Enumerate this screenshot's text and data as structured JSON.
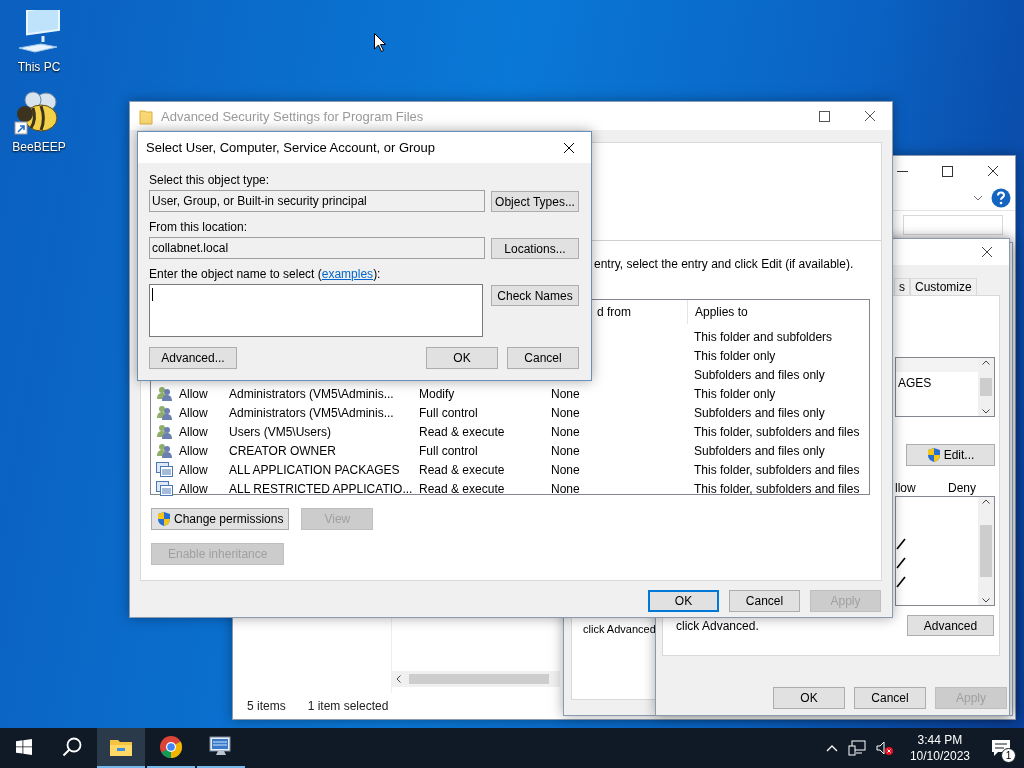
{
  "desktop_icons": [
    {
      "kind": "pc",
      "label": "This PC"
    },
    {
      "kind": "bee",
      "label": "BeeBEEP"
    }
  ],
  "explorer_window": {
    "status": [
      "5 items",
      "1 item selected"
    ]
  },
  "properties_back": {
    "note": "click Advanced"
  },
  "properties_front": {
    "tabs": [
      {
        "label": "s",
        "selected": false
      },
      {
        "label": "Customize",
        "selected": false
      }
    ],
    "group_items": [
      "AGES"
    ],
    "edit_button": "Edit...",
    "permission_columns": [
      "llow",
      "Deny"
    ],
    "permissions": [
      {
        "allowed": true
      },
      {
        "allowed": true
      },
      {
        "allowed": true
      }
    ],
    "note": "click Advanced.",
    "advanced_button": "Advanced",
    "buttons": [
      {
        "label": "OK",
        "disabled": false
      },
      {
        "label": "Cancel",
        "disabled": false
      },
      {
        "label": "Apply",
        "disabled": true
      }
    ]
  },
  "advanced_security": {
    "title": "Advanced Security Settings for Program Files",
    "instruction": "entry, select the entry and click Edit (if available).",
    "columns": [
      "d from",
      "Applies to"
    ],
    "entries": [
      {
        "applies_to": "This folder and subfolders"
      },
      {
        "applies_to": "This folder only"
      },
      {
        "applies_to": "Subfolders and files only"
      },
      {
        "kind": "users",
        "type": "Allow",
        "principal": "Administrators (VM5\\Adminis...",
        "access": "Modify",
        "inherited_from": "None",
        "applies_to": "This folder only"
      },
      {
        "kind": "users",
        "type": "Allow",
        "principal": "Administrators (VM5\\Adminis...",
        "access": "Full control",
        "inherited_from": "None",
        "applies_to": "Subfolders and files only"
      },
      {
        "kind": "users",
        "type": "Allow",
        "principal": "Users (VM5\\Users)",
        "access": "Read & execute",
        "inherited_from": "None",
        "applies_to": "This folder, subfolders and files"
      },
      {
        "kind": "users",
        "type": "Allow",
        "principal": "CREATOR OWNER",
        "access": "Full control",
        "inherited_from": "None",
        "applies_to": "Subfolders and files only"
      },
      {
        "kind": "packages",
        "type": "Allow",
        "principal": "ALL APPLICATION PACKAGES",
        "access": "Read & execute",
        "inherited_from": "None",
        "applies_to": "This folder, subfolders and files"
      },
      {
        "kind": "packages",
        "type": "Allow",
        "principal": "ALL RESTRICTED APPLICATIO...",
        "access": "Read & execute",
        "inherited_from": "None",
        "applies_to": "This folder, subfolders and files"
      }
    ],
    "action_buttons": [
      {
        "label": "Change permissions",
        "shield": true,
        "disabled": false
      },
      {
        "label": "View",
        "shield": false,
        "disabled": true
      },
      {
        "label": "Enable inheritance",
        "shield": false,
        "disabled": true
      }
    ],
    "buttons": [
      {
        "label": "OK",
        "disabled": false,
        "focused": true
      },
      {
        "label": "Cancel",
        "disabled": false,
        "focused": false
      },
      {
        "label": "Apply",
        "disabled": true,
        "focused": false
      }
    ]
  },
  "select_dialog": {
    "title": "Select User, Computer, Service Account, or Group",
    "object_type_label": "Select this object type:",
    "object_type": "User, Group, or Built-in security principal",
    "object_types_button": "Object Types...",
    "location_label": "From this location:",
    "location": "collabnet.local",
    "locations_button": "Locations...",
    "name_label": {
      "before": "Enter the object name to select (",
      "link": "examples",
      "after": "):"
    },
    "check_names_button": "Check Names",
    "advanced_button": "Advanced...",
    "buttons": [
      "OK",
      "Cancel"
    ]
  },
  "taskbar": {
    "apps": [
      {
        "kind": "start"
      },
      {
        "kind": "search"
      },
      {
        "kind": "explorer",
        "running": true,
        "active": true
      },
      {
        "kind": "chrome",
        "running": true,
        "active": false
      },
      {
        "kind": "monitor",
        "running": true,
        "active": false
      }
    ],
    "time": "3:44 PM",
    "date": "10/10/2023",
    "notification_count": "1"
  }
}
